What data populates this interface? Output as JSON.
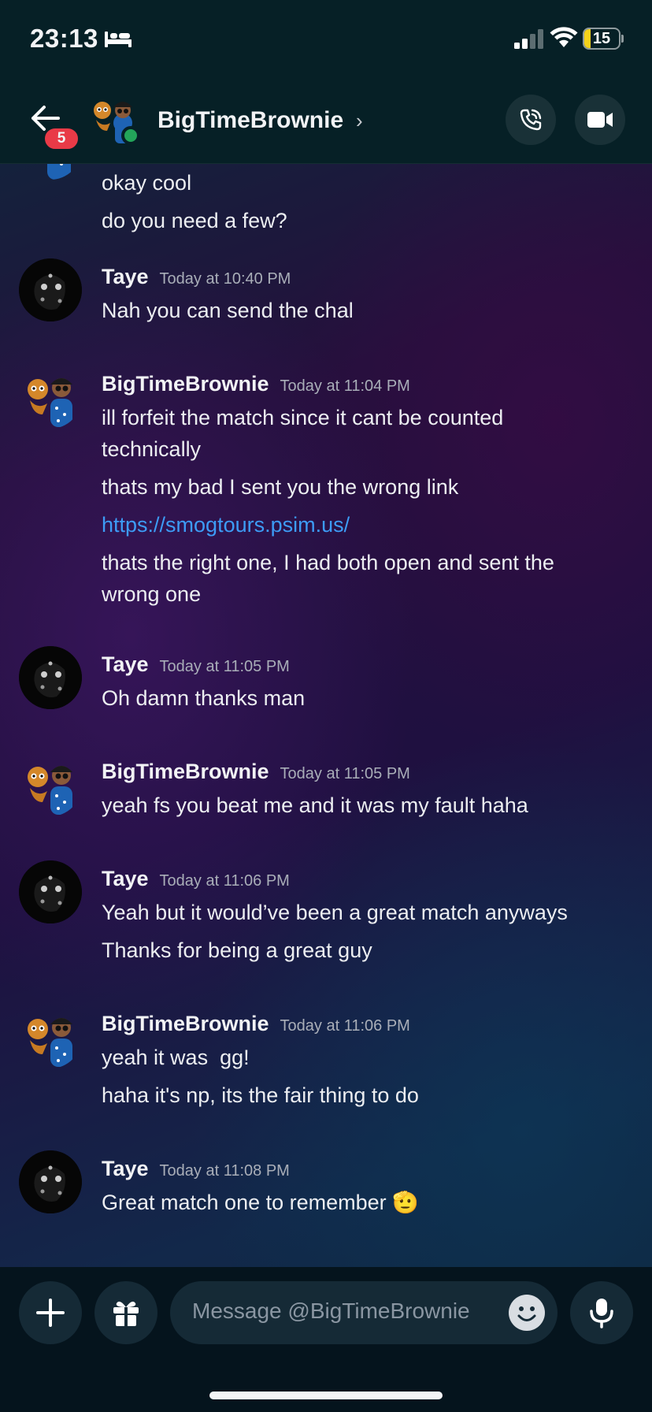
{
  "status_bar": {
    "time": "23:13",
    "battery": "15",
    "icons": [
      "bed-icon",
      "cellular-signal-icon",
      "wifi-icon",
      "battery-icon"
    ]
  },
  "header": {
    "unread_badge": "5",
    "contact_name": "BigTimeBrownie",
    "online_status_color": "#23a55a",
    "icons": [
      "back-arrow-icon",
      "chevron-right-icon",
      "phone-call-icon",
      "video-camera-icon"
    ]
  },
  "conversation": {
    "partial_top": {
      "lines": [
        "okay cool",
        "do you need a few?"
      ]
    },
    "groups": [
      {
        "author": "Taye",
        "time": "Today at 10:40 PM",
        "lines": [
          "Nah you can send the chal"
        ]
      },
      {
        "author": "BigTimeBrownie",
        "time": "Today at 11:04 PM",
        "lines": [
          "ill forfeit the match since it cant be counted technically",
          "thats my bad I sent you the wrong link",
          "https://smogtours.psim.us/",
          "thats the right one, I had both open and sent the wrong one"
        ]
      },
      {
        "author": "Taye",
        "time": "Today at 11:05 PM",
        "lines": [
          "Oh damn thanks man"
        ]
      },
      {
        "author": "BigTimeBrownie",
        "time": "Today at 11:05 PM",
        "lines": [
          "yeah fs you beat me and it was my fault haha"
        ]
      },
      {
        "author": "Taye",
        "time": "Today at 11:06 PM",
        "lines": [
          "Yeah but it would’ve been a great match anyways",
          "Thanks for being a great guy"
        ]
      },
      {
        "author": "BigTimeBrownie",
        "time": "Today at 11:06 PM",
        "lines": [
          "yeah it was  gg!",
          "haha it's np, its the fair thing to do"
        ]
      },
      {
        "author": "Taye",
        "time": "Today at 11:08 PM",
        "lines": [
          "Great match one to remember 🫡"
        ]
      }
    ]
  },
  "composer": {
    "placeholder": "Message @BigTimeBrownie",
    "icons": [
      "plus-icon",
      "gift-icon",
      "emoji-icon",
      "microphone-icon"
    ]
  },
  "colors": {
    "link": "#3d9cf6",
    "badge": "#e93a47",
    "header_bg": "#062026"
  }
}
